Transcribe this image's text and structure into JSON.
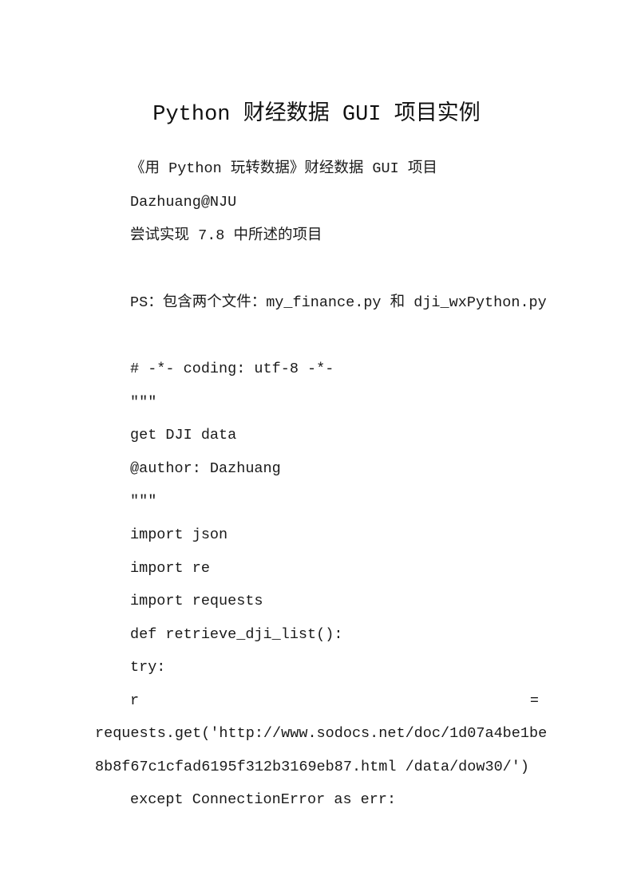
{
  "document": {
    "title": "Python 财经数据 GUI 项目实例",
    "intro": {
      "subtitle": "《用 Python 玩转数据》财经数据 GUI 项目",
      "author": "Dazhuang@NJU",
      "description": "尝试实现 7.8 中所述的项目",
      "ps_note": "PS：包含两个文件：my_finance.py 和 dji_wxPython.py"
    },
    "code_lines": {
      "coding": "# -*- coding: utf-8 -*-",
      "docstring_open": "″″″",
      "doc_text": "get DJI data",
      "author_tag": "@author: Dazhuang",
      "docstring_close": "″″″",
      "import_json": "import json",
      "import_re": "import re",
      "import_requests": "import requests",
      "def_line": "def retrieve_dji_list():",
      "try_line": "try:",
      "assign_lhs": "r",
      "assign_eq": "=",
      "request_line_1": "requests.get('http://www.sodocs.net/doc/1d07a4be1be",
      "request_line_2": "8b8f67c1cfad6195f312b3169eb87.html /data/dow30/')",
      "except_line": "except ConnectionError as err:"
    }
  }
}
